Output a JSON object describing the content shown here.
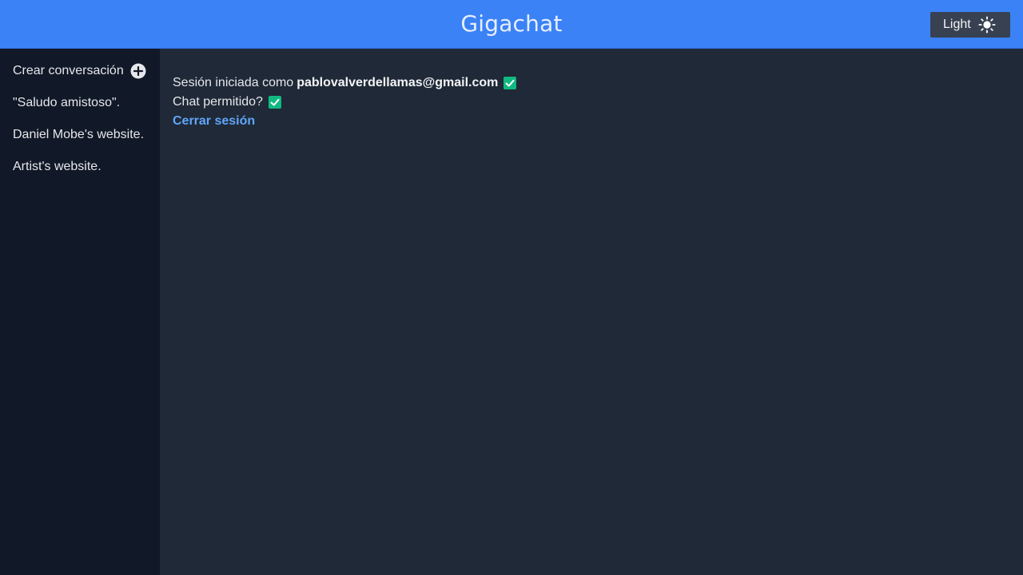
{
  "header": {
    "title": "Gigachat",
    "theme_button_label": "Light",
    "theme_icon": "sun-icon"
  },
  "sidebar": {
    "create_label": "Crear conversación",
    "create_icon": "plus-circle-icon",
    "conversations": [
      "\"Saludo amistoso\".",
      "Daniel Mobe's website.",
      "Artist's website."
    ]
  },
  "main": {
    "session_prefix": "Sesión iniciada como",
    "email": "pablovalverdellamas@gmail.com",
    "chat_allowed_label": "Chat permitido?",
    "logout_label": "Cerrar sesión",
    "check_icon": "check-square-icon"
  },
  "colors": {
    "header_bg": "#3b82f6",
    "sidebar_bg": "#111827",
    "main_bg": "#1f2937",
    "check_green": "#10b981",
    "link_blue": "#60a5fa"
  }
}
